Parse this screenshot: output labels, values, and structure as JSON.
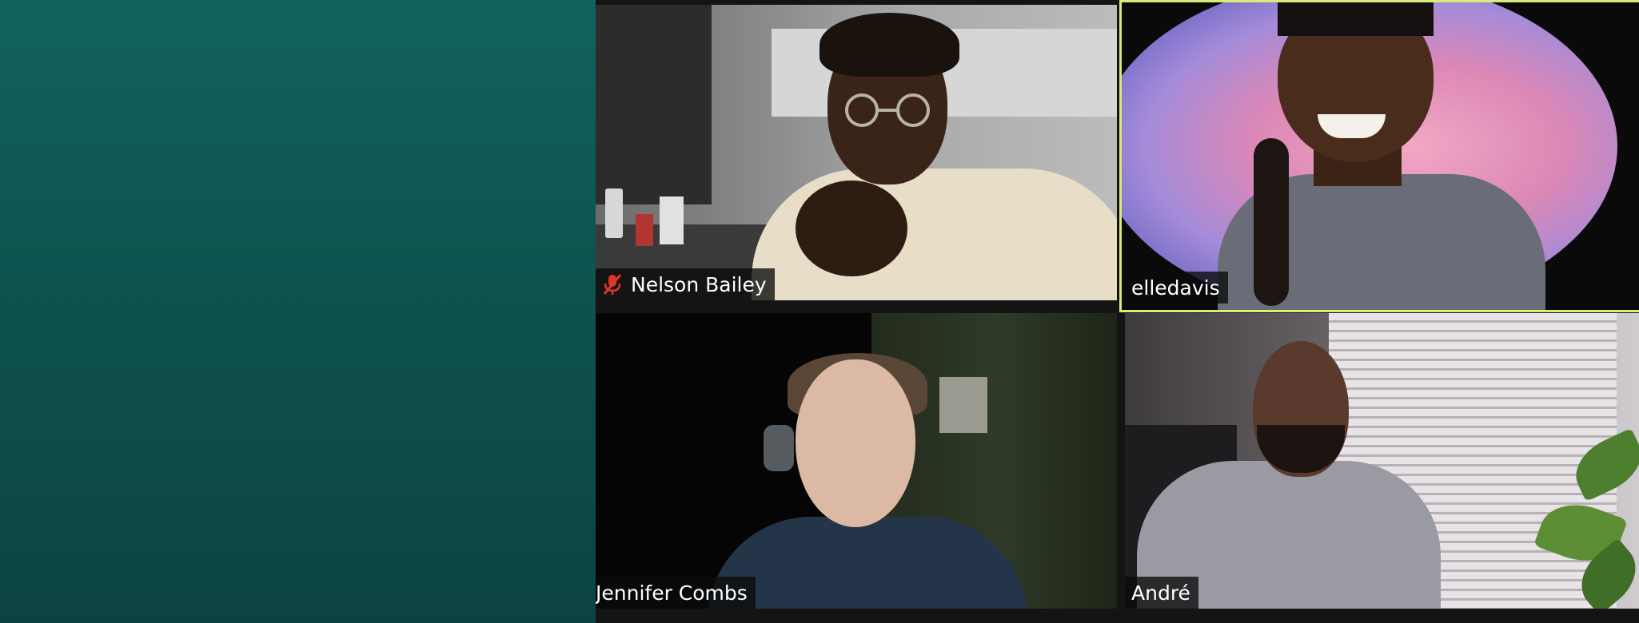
{
  "participants": [
    {
      "name": "Nelson Bailey",
      "muted": true,
      "active_speaker": false,
      "mic_icon": "mic-muted-icon"
    },
    {
      "name": "elledavis",
      "muted": false,
      "active_speaker": true
    },
    {
      "name": "Jennifer Combs",
      "muted": false,
      "active_speaker": false
    },
    {
      "name": "André",
      "muted": false,
      "active_speaker": false
    }
  ],
  "colors": {
    "active_speaker_border": "#d8ec7a",
    "side_panel_top": "#10625f",
    "side_panel_bottom": "#0b4342",
    "muted_icon": "#e0352b",
    "name_tag_bg": "#0a0a0a"
  }
}
